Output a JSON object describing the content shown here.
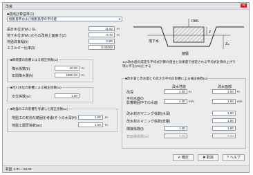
{
  "window": {
    "title": "改良"
  },
  "top": {
    "section_label": "■適用計算基準(1)",
    "standard_select": "掘削基準および掘削基準の平均値",
    "ground_elev_label": "設計水位(DWL) GL",
    "ground_elev_value": "11.62",
    "ground_elev_unit": "m",
    "design_depth_label": "地下水位(DWL)からの改良上面高さ(Z)",
    "design_depth_value": "0.70",
    "design_depth_unit": "m",
    "ground_rate_label": "地盤改良幅(b)",
    "ground_rate_value": "0.00",
    "energy_label": "エネルギー比率(δ)",
    "energy_value": "0.00000"
  },
  "group_water": {
    "title": "■降雨量の影響による補正係数(ω)",
    "rain_label": "降水係数(b)",
    "rain_value": "20.00",
    "rain_unit": "m",
    "annual_label": "年間降水量(h)",
    "annual_value": "1800.00",
    "annual_unit": "m"
  },
  "group_river": {
    "title": "■河川水位の影響による補正係数(ω)",
    "coef_label": "水位係数(ω)",
    "coef_value": "1.00"
  },
  "group_layer": {
    "title": "■地盤の工の影響を考慮した補正係数(ω)",
    "l1_label": "地盤工の有効な範囲を考慮(そうの水深(H)",
    "l1_value": "1.00",
    "l1_unit": "m",
    "l2_label": "地盤工層厚係数(ac)",
    "l2_value": "1.00",
    "l2_unit": "m"
  },
  "diagram": {
    "label_dwl": "DWL",
    "label_groundwater": "地下水",
    "label_z": "Z",
    "label_zm": "Zₘ",
    "label_base": "基盤"
  },
  "note": {
    "line1": "※Z:改水面の成定を平均式計算の値合と効果量で想定される平均式計算の上がり",
    "line2": "現に平を(Zm)とする"
  },
  "group_right": {
    "title": "■改水管と改水面との高さの平均の影響による補正係数(ω)",
    "col1": "改水性能",
    "col2": "改水面部",
    "r1_label": "改深",
    "r1_v1": "1.00",
    "r1_u1": "m",
    "r1_v2": "1.00",
    "r1_u2": "m",
    "r2_label": "平均水面の",
    "r2_label2": "影響範囲中での水面",
    "r2_v1": "1.00",
    "r2_u1": "m/s",
    "r2_v2": "1.00",
    "r2_u2": "m/s",
    "r3_label": "改水材のマニング係数(水深)",
    "r3_v1": "1.00",
    "r3_v2": "1.00",
    "r4_label": "改水材のマニング係数(流量)",
    "r4_v1": "1.00",
    "r4_v2": "1.00",
    "r5_label": "隣接係数(f)",
    "r5_v1": "1.00",
    "r5_v2": "1.00",
    "r6_label": "表面積係数(ω)",
    "r6_v1": "0.00",
    "r6_v2": "0.00"
  },
  "buttons": {
    "ok": "✔ 確定",
    "cancel": "✖ 取消",
    "help": "? ヘルプ"
  },
  "status": {
    "text": "範囲: 0.01 ~ 99.99"
  }
}
